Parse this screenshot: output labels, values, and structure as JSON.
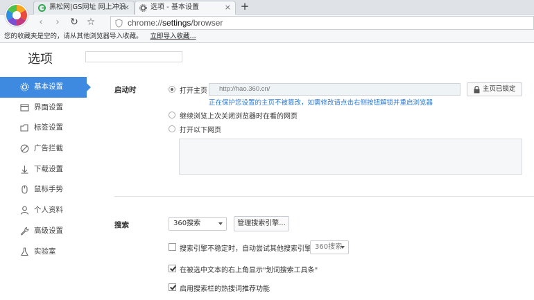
{
  "tabs": [
    {
      "title": "黑松网|GS网址 网上冲浪",
      "close": "×"
    },
    {
      "title": "选项 - 基本设置",
      "close": "×"
    }
  ],
  "new_tab_label": "+",
  "toolbar": {
    "back": "‹",
    "forward": "›",
    "reload": "↻",
    "star": "☆",
    "url_prefix": "chrome://",
    "url_host": "settings",
    "url_path": "/browser"
  },
  "bookmarks": {
    "empty_text": "您的收藏夹是空的，请从其他浏览器导入收藏。",
    "import_link": "立即导入收藏..."
  },
  "page": {
    "title": "选项",
    "search_placeholder": ""
  },
  "sidebar": {
    "items": [
      {
        "label": "基本设置",
        "icon": "gear-icon",
        "active": true
      },
      {
        "label": "界面设置",
        "icon": "window-icon"
      },
      {
        "label": "标签设置",
        "icon": "tab-icon"
      },
      {
        "label": "广告拦截",
        "icon": "block-icon"
      },
      {
        "label": "下载设置",
        "icon": "download-icon"
      },
      {
        "label": "鼠标手势",
        "icon": "mouse-icon"
      },
      {
        "label": "个人资料",
        "icon": "person-icon"
      },
      {
        "label": "高级设置",
        "icon": "wrench-icon"
      },
      {
        "label": "实验室",
        "icon": "flask-icon"
      }
    ]
  },
  "startup": {
    "label": "启动时",
    "option_homepage": "打开主页",
    "homepage_url": "http://hao.360.cn/",
    "lock_button": "主页已锁定",
    "hint": "正在保护您设置的主页不被篡改，如需修改请点击右侧按钮解锁并重启浏览器",
    "option_continue": "继续浏览上次关闭浏览器时在看的网页",
    "option_pages": "打开以下网页"
  },
  "search": {
    "label": "搜索",
    "engine": "360搜索",
    "manage_button": "管理搜索引擎...",
    "fallback_label": "搜索引擎不稳定时，自动尝试其他搜索引擎：",
    "fallback_engine": "360搜索",
    "show_toolbar": "在被选中文本的右上角显示\"划词搜索工具条\"",
    "hot_words": "启用搜索栏的热搜词推荐功能"
  },
  "colors": {
    "accent": "#3d8ae0",
    "hint": "#2a7ad5"
  }
}
